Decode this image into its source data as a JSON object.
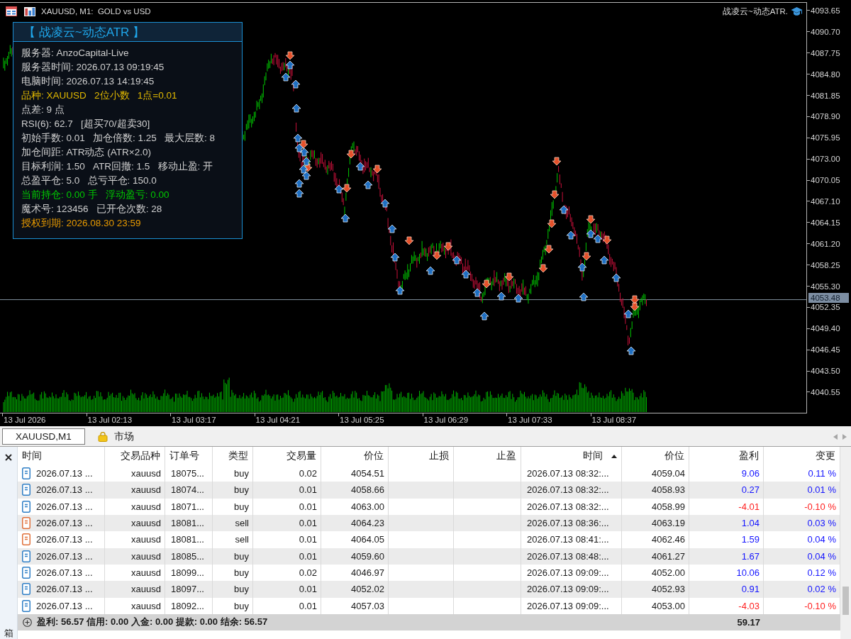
{
  "chart_window": {
    "title": "XAUUSD, M1:  GOLD vs USD",
    "indicator_label": "战凌云~动态ATR.",
    "price_axis": [
      "4093.65",
      "4090.70",
      "4087.75",
      "4084.80",
      "4081.85",
      "4078.90",
      "4075.95",
      "4073.00",
      "4070.05",
      "4067.10",
      "4064.15",
      "4061.20",
      "4058.25",
      "4055.30",
      "4052.35",
      "4049.40",
      "4046.45",
      "4043.50",
      "4040.55"
    ],
    "current_price": "4053.48",
    "time_axis": [
      "13 Jul 2026",
      "13 Jul 02:13",
      "13 Jul 03:17",
      "13 Jul 04:21",
      "13 Jul 05:25",
      "13 Jul 06:29",
      "13 Jul 07:33",
      "13 Jul 08:37"
    ]
  },
  "info_panel": {
    "title": "【 战凌云~动态ATR 】",
    "lines": [
      {
        "text": "服务器: AnzoCapital-Live",
        "color": "#cfcfcf"
      },
      {
        "text": "服务器时间: 2026.07.13 09:19:45",
        "color": "#cfcfcf"
      },
      {
        "text": "电脑时间: 2026.07.13 14:19:45",
        "color": "#cfcfcf"
      },
      {
        "text": "品种: XAUUSD   2位小数   1点=0.01",
        "color": "#e0b800"
      },
      {
        "text": "点差: 9 点",
        "color": "#cfcfcf"
      },
      {
        "text": "RSI(6): 62.7   [超买70/超卖30]",
        "color": "#cfcfcf"
      },
      {
        "text": "初始手数: 0.01   加仓倍数: 1.25   最大层数: 8",
        "color": "#cfcfcf"
      },
      {
        "text": "加仓间距: ATR动态 (ATR×2.0)",
        "color": "#cfcfcf"
      },
      {
        "text": "目标利润: 1.50   ATR回撤: 1.5   移动止盈: 开",
        "color": "#cfcfcf"
      },
      {
        "text": "总盈平仓: 5.0   总亏平仓: 150.0",
        "color": "#cfcfcf"
      },
      {
        "text": "当前持仓: 0.00 手   浮动盈亏: 0.00",
        "color": "#00c800"
      },
      {
        "text": "魔术号: 123456   已开仓次数: 28",
        "color": "#cfcfcf"
      },
      {
        "text": "授权到期: 2026.08.30 23:59",
        "color": "#e89a00"
      }
    ]
  },
  "chart_tabs": [
    {
      "label": "XAUUSD,M1",
      "kind": "chart",
      "selected": true
    },
    {
      "label": "市场",
      "kind": "market",
      "selected": false
    }
  ],
  "toolbox": {
    "side_label": "箱",
    "table": {
      "columns": [
        {
          "label": "时间",
          "sorted": false
        },
        {
          "label": "交易品种",
          "sorted": false
        },
        {
          "label": "订单号",
          "sorted": false
        },
        {
          "label": "类型",
          "sorted": false
        },
        {
          "label": "交易量",
          "sorted": false
        },
        {
          "label": "价位",
          "sorted": false
        },
        {
          "label": "止损",
          "sorted": false
        },
        {
          "label": "止盈",
          "sorted": false
        },
        {
          "label": "时间",
          "sorted": true
        },
        {
          "label": "价位",
          "sorted": false
        },
        {
          "label": "盈利",
          "sorted": false
        },
        {
          "label": "变更",
          "sorted": false
        }
      ],
      "rows": [
        {
          "kind": "buy",
          "open_time": "2026.07.13 ...",
          "symbol": "xauusd",
          "ticket": "18075...",
          "type": "buy",
          "volume": "0.02",
          "open_price": "4054.51",
          "close_time": "2026.07.13 08:32:...",
          "close_price": "4059.04",
          "profit": "9.06",
          "change": "0.11 %",
          "loss": false
        },
        {
          "kind": "buy",
          "open_time": "2026.07.13 ...",
          "symbol": "xauusd",
          "ticket": "18074...",
          "type": "buy",
          "volume": "0.01",
          "open_price": "4058.66",
          "close_time": "2026.07.13 08:32:...",
          "close_price": "4058.93",
          "profit": "0.27",
          "change": "0.01 %",
          "loss": false
        },
        {
          "kind": "buy",
          "open_time": "2026.07.13 ...",
          "symbol": "xauusd",
          "ticket": "18071...",
          "type": "buy",
          "volume": "0.01",
          "open_price": "4063.00",
          "close_time": "2026.07.13 08:32:...",
          "close_price": "4058.99",
          "profit": "-4.01",
          "change": "-0.10 %",
          "loss": true
        },
        {
          "kind": "sell",
          "open_time": "2026.07.13 ...",
          "symbol": "xauusd",
          "ticket": "18081...",
          "type": "sell",
          "volume": "0.01",
          "open_price": "4064.23",
          "close_time": "2026.07.13 08:36:...",
          "close_price": "4063.19",
          "profit": "1.04",
          "change": "0.03 %",
          "loss": false
        },
        {
          "kind": "sell",
          "open_time": "2026.07.13 ...",
          "symbol": "xauusd",
          "ticket": "18081...",
          "type": "sell",
          "volume": "0.01",
          "open_price": "4064.05",
          "close_time": "2026.07.13 08:41:...",
          "close_price": "4062.46",
          "profit": "1.59",
          "change": "0.04 %",
          "loss": false
        },
        {
          "kind": "buy",
          "open_time": "2026.07.13 ...",
          "symbol": "xauusd",
          "ticket": "18085...",
          "type": "buy",
          "volume": "0.01",
          "open_price": "4059.60",
          "close_time": "2026.07.13 08:48:...",
          "close_price": "4061.27",
          "profit": "1.67",
          "change": "0.04 %",
          "loss": false
        },
        {
          "kind": "buy",
          "open_time": "2026.07.13 ...",
          "symbol": "xauusd",
          "ticket": "18099...",
          "type": "buy",
          "volume": "0.02",
          "open_price": "4046.97",
          "close_time": "2026.07.13 09:09:...",
          "close_price": "4052.00",
          "profit": "10.06",
          "change": "0.12 %",
          "loss": false
        },
        {
          "kind": "buy",
          "open_time": "2026.07.13 ...",
          "symbol": "xauusd",
          "ticket": "18097...",
          "type": "buy",
          "volume": "0.01",
          "open_price": "4052.02",
          "close_time": "2026.07.13 09:09:...",
          "close_price": "4052.93",
          "profit": "0.91",
          "change": "0.02 %",
          "loss": false
        },
        {
          "kind": "buy",
          "open_time": "2026.07.13 ...",
          "symbol": "xauusd",
          "ticket": "18092...",
          "type": "buy",
          "volume": "0.01",
          "open_price": "4057.03",
          "close_time": "2026.07.13 09:09:...",
          "close_price": "4053.00",
          "profit": "-4.03",
          "change": "-0.10 %",
          "loss": true
        }
      ],
      "summary": {
        "text": "盈利: 56.57 信用: 0.00 入金: 0.00 提款: 0.00 结余: 56.57",
        "total_profit": "59.17"
      }
    }
  }
}
